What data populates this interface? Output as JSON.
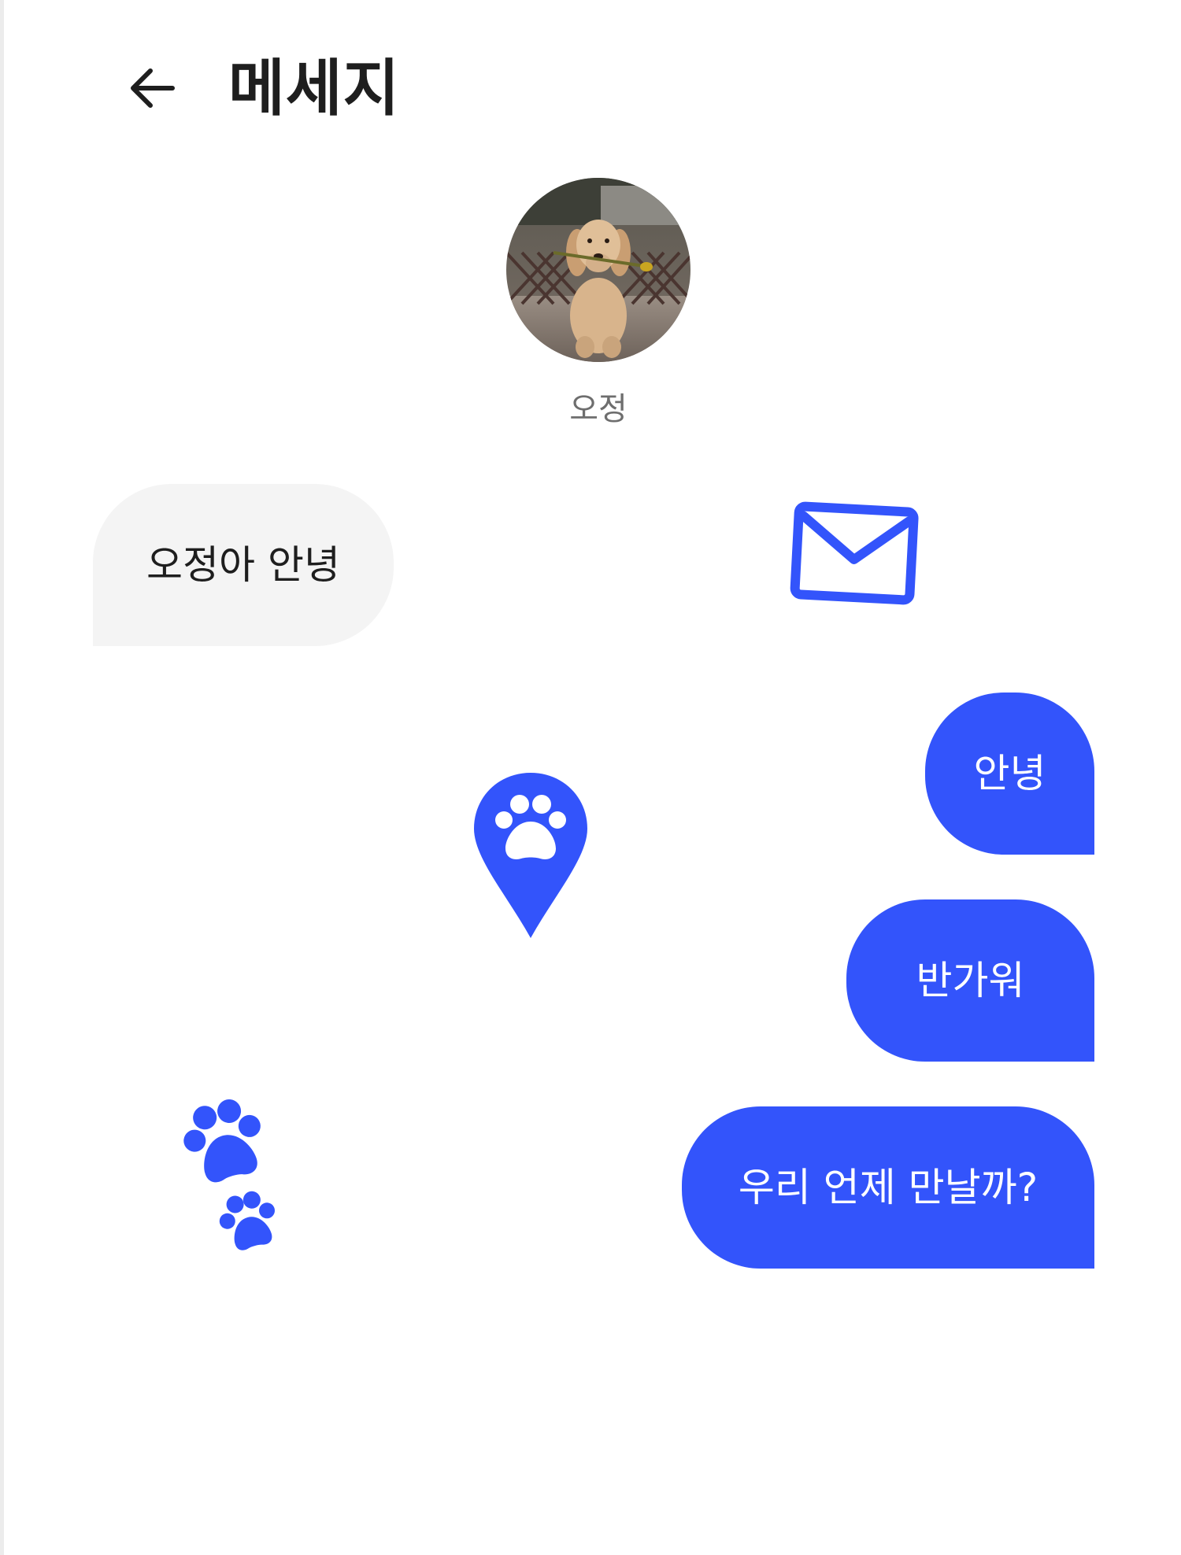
{
  "header": {
    "title": "메세지",
    "back_icon": "arrow-left-icon"
  },
  "contact": {
    "name": "오정",
    "avatar_icon": "dog-photo"
  },
  "messages": [
    {
      "direction": "received",
      "text": "오정아 안녕"
    },
    {
      "direction": "sent",
      "text": "안녕"
    },
    {
      "direction": "sent",
      "text": "반가워"
    },
    {
      "direction": "sent",
      "text": "우리 언제 만날까?"
    }
  ],
  "decorations": [
    "envelope-icon",
    "paw-location-pin-icon",
    "paw-prints-icon"
  ],
  "colors": {
    "accent": "#3354fb",
    "received_bubble": "#f4f4f4",
    "text_dark": "#1e1e1e",
    "text_muted": "#6e6e6e",
    "background": "#ffffff"
  }
}
